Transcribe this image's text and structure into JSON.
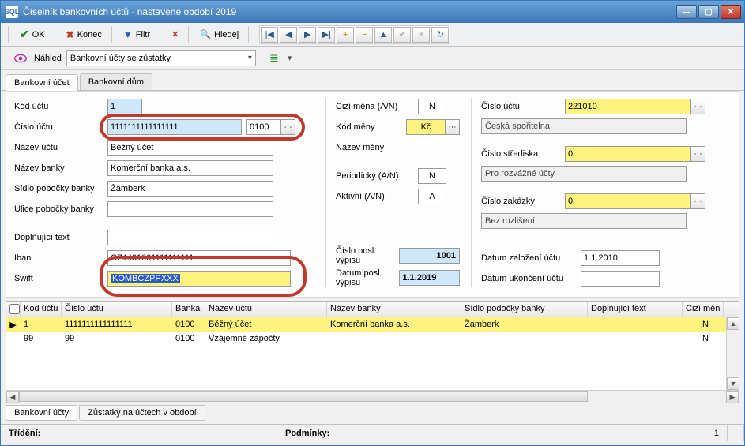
{
  "window": {
    "title": "Číselník bankovních účtů - nastavené období 2019",
    "app_icon_label": "SQL"
  },
  "toolbar": {
    "ok": "OK",
    "konec": "Konec",
    "filtr": "Filtr",
    "hledej": "Hledej"
  },
  "subbar": {
    "nahled": "Náhled",
    "combo_value": "Bankovní účty se zůstatky"
  },
  "tabs": {
    "tab1": "Bankovní účet",
    "tab2": "Bankovní dům"
  },
  "form": {
    "labels": {
      "kod_uctu": "Kód účtu",
      "cislo_uctu": "Číslo účtu",
      "nazev_uctu": "Název účtu",
      "nazev_banky": "Název banky",
      "sidlo_pobocky": "Sídlo pobočky banky",
      "ulice_pobocky": "Ulice pobočky banky",
      "doplnujici": "Doplňující text",
      "iban": "Iban",
      "swift": "Swift",
      "cizi_mena": "Cizí měna (A/N)",
      "kod_meny": "Kód měny",
      "nazev_meny": "Název měny",
      "periodicky": "Periodický (A/N)",
      "aktivni": "Aktivní (A/N)",
      "cislo_posl_vypisu": "Číslo posl. výpisu",
      "datum_posl_vypisu": "Datum posl. výpisu",
      "cislo_uctu_ref": "Číslo účtu",
      "ceska_sporitelna": "Česká spořitelna",
      "cislo_strediska": "Číslo střediska",
      "pro_rozvazne": "Pro rozvážné účty",
      "cislo_zakazky": "Číslo zakázky",
      "bez_rozliseni": "Bez rozlišení",
      "datum_zalozeni": "Datum založení účtu",
      "datum_ukonceni": "Datum ukončení účtu"
    },
    "values": {
      "kod_uctu": "1",
      "cislo_uctu": "1111111111111111",
      "bank_code": "0100",
      "nazev_uctu": "Běžný účet",
      "nazev_banky": "Komerční banka a.s.",
      "sidlo_pobocky": "Žamberk",
      "ulice_pobocky": "",
      "doplnujici": "",
      "iban": "CZ4401001111111111",
      "swift": "KOMBCZPPXXX",
      "cizi_mena": "N",
      "kod_meny": "Kč",
      "nazev_meny": "",
      "periodicky": "N",
      "aktivni": "A",
      "cislo_posl_vypisu": "1001",
      "datum_posl_vypisu": "1.1.2019",
      "cislo_uctu_ref": "221010",
      "cislo_strediska": "0",
      "cislo_zakazky": "0",
      "datum_zalozeni": "1.1.2010",
      "datum_ukonceni": ""
    }
  },
  "grid": {
    "headers": {
      "kod": "Kód účtu",
      "cislo": "Číslo účtu",
      "banka": "Banka",
      "nazev": "Název účtu",
      "nazev_banky": "Název banky",
      "sidlo": "Sídlo podočky banky",
      "dopln": "Doplňující text",
      "cizi": "Cizí měn"
    },
    "rows": [
      {
        "mark": "▶",
        "kod": "1",
        "cislo": "1111111111111111",
        "banka": "0100",
        "nazev": "Běžný účet",
        "nazev_banky": "Komerční banka a.s.",
        "sidlo": "Žamberk",
        "dopln": "",
        "cizi": "N",
        "selected": true
      },
      {
        "mark": "",
        "kod": "99",
        "cislo": "99",
        "banka": "0100",
        "nazev": "Vzájemné zápočty",
        "nazev_banky": "",
        "sidlo": "",
        "dopln": "",
        "cizi": "N",
        "selected": false
      }
    ]
  },
  "bottom_tabs": {
    "tab1": "Bankovní účty",
    "tab2": "Zůstatky na účtech v období"
  },
  "status": {
    "trideni": "Třídění:",
    "podminky": "Podmínky:",
    "count": "1"
  }
}
